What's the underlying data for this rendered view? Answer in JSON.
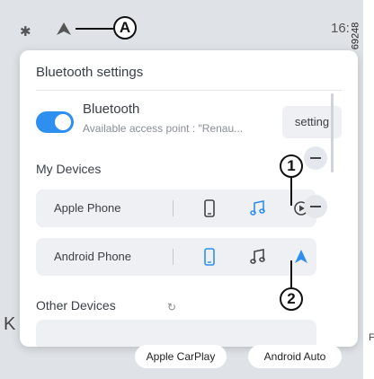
{
  "status_bar": {
    "bluetooth_icon": "bluetooth-icon",
    "android_auto_icon": "android-auto-icon",
    "clock": "16:",
    "callout_a": "A"
  },
  "document_reference": "69248",
  "panel": {
    "title": "Bluetooth settings",
    "bluetooth": {
      "label": "Bluetooth",
      "toggle_on": true,
      "access_point": "Available access point : \"Renau...",
      "setting_button": "setting"
    },
    "my_devices": {
      "heading": "My Devices",
      "devices": [
        {
          "name": "Apple Phone",
          "icons": [
            "phone-icon",
            "music-icon",
            "carplay-icon"
          ],
          "active_color": "#2f8ff0"
        },
        {
          "name": "Android Phone",
          "icons": [
            "phone-icon",
            "music-icon",
            "android-auto-icon"
          ],
          "active_color": "#2f8ff0"
        }
      ]
    },
    "other_devices": {
      "heading": "Other Devices",
      "refresh_icon": "refresh-icon"
    }
  },
  "callouts": {
    "one": "1",
    "two": "2"
  },
  "bottom_bar": {
    "carplay": "Apple CarPlay",
    "android_auto": "Android Auto",
    "left_edge": "K",
    "right_edge": "F"
  },
  "colors": {
    "accent": "#2f8ff0",
    "background": "#dfe3e8",
    "panel": "#ffffff",
    "row": "#eef0f3"
  }
}
